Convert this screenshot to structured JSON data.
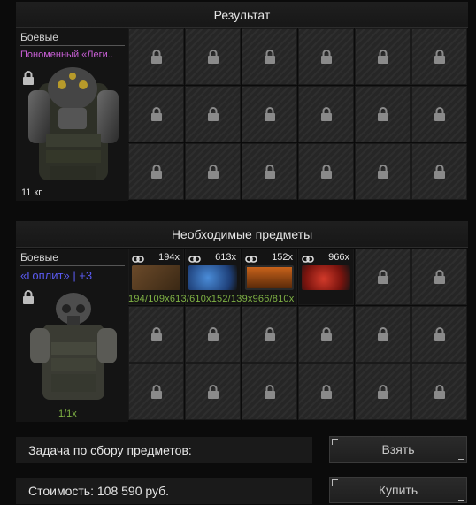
{
  "result": {
    "header": "Результат",
    "item": {
      "category": "Боевые",
      "name": "Пономенный «Леги..",
      "weight": "11 кг",
      "name_color": "#c95fd6"
    }
  },
  "required": {
    "header": "Необходимые предметы",
    "item": {
      "category": "Боевые",
      "name": "«Гоплит» | +3",
      "name_color": "#5555ee",
      "craft_count": "1/1x"
    },
    "materials": [
      {
        "qty": "194x",
        "progress": "194/109x",
        "icon": "brown-material-icon"
      },
      {
        "qty": "613x",
        "progress": "613/610x",
        "icon": "blue-crystal-icon"
      },
      {
        "qty": "152x",
        "progress": "152/139x",
        "icon": "orange-device-icon"
      },
      {
        "qty": "966x",
        "progress": "966/810x",
        "icon": "red-ore-icon"
      }
    ],
    "progress_line": "194/109x613/610x152/139x966/810x"
  },
  "task": {
    "label": "Задача по сбору предметов:",
    "button": "Взять"
  },
  "cost": {
    "label": "Стоимость: 108 590  руб.",
    "button": "Купить"
  }
}
